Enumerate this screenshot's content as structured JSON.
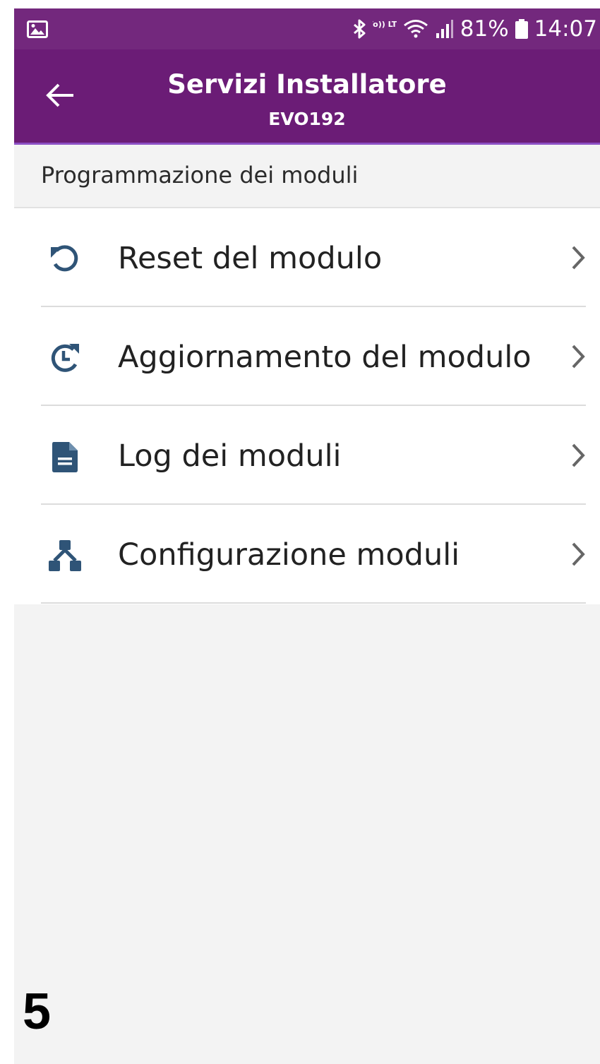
{
  "status_bar": {
    "battery": "81%",
    "time": "14:07",
    "volte_label": "Vo)) LTE",
    "icons": [
      "gallery-icon",
      "bluetooth-icon",
      "volte-icon",
      "wifi-icon",
      "signal-icon",
      "battery-icon"
    ]
  },
  "app_bar": {
    "title": "Servizi Installatore",
    "subtitle": "EVO192",
    "back_icon": "arrow-left-icon"
  },
  "section": {
    "title": "Programmazione dei moduli"
  },
  "menu": {
    "items": [
      {
        "label": "Reset del modulo",
        "icon": "reset-icon"
      },
      {
        "label": "Aggiornamento del modulo",
        "icon": "update-icon"
      },
      {
        "label": "Log dei moduli",
        "icon": "document-icon"
      },
      {
        "label": "Configurazione moduli",
        "icon": "network-icon"
      }
    ]
  },
  "page_number": "5",
  "colors": {
    "statusbar": "#73287d",
    "appbar": "#6b1c76",
    "icon": "#2f5477",
    "background": "#f3f3f3"
  }
}
